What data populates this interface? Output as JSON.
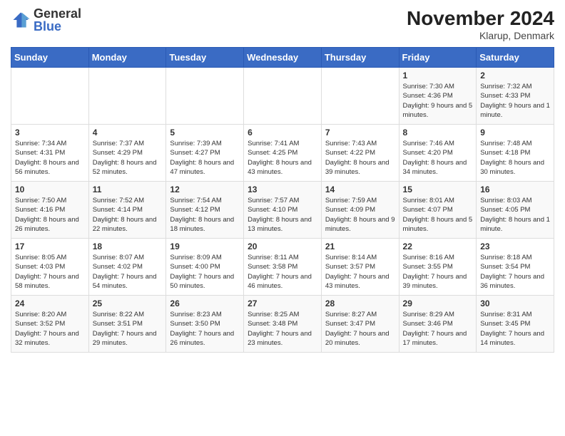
{
  "logo": {
    "text_top": "General",
    "text_bottom": "Blue"
  },
  "title": "November 2024",
  "subtitle": "Klarup, Denmark",
  "days_of_week": [
    "Sunday",
    "Monday",
    "Tuesday",
    "Wednesday",
    "Thursday",
    "Friday",
    "Saturday"
  ],
  "weeks": [
    [
      {
        "day": "",
        "info": ""
      },
      {
        "day": "",
        "info": ""
      },
      {
        "day": "",
        "info": ""
      },
      {
        "day": "",
        "info": ""
      },
      {
        "day": "",
        "info": ""
      },
      {
        "day": "1",
        "info": "Sunrise: 7:30 AM\nSunset: 4:36 PM\nDaylight: 9 hours and 5 minutes."
      },
      {
        "day": "2",
        "info": "Sunrise: 7:32 AM\nSunset: 4:33 PM\nDaylight: 9 hours and 1 minute."
      }
    ],
    [
      {
        "day": "3",
        "info": "Sunrise: 7:34 AM\nSunset: 4:31 PM\nDaylight: 8 hours and 56 minutes."
      },
      {
        "day": "4",
        "info": "Sunrise: 7:37 AM\nSunset: 4:29 PM\nDaylight: 8 hours and 52 minutes."
      },
      {
        "day": "5",
        "info": "Sunrise: 7:39 AM\nSunset: 4:27 PM\nDaylight: 8 hours and 47 minutes."
      },
      {
        "day": "6",
        "info": "Sunrise: 7:41 AM\nSunset: 4:25 PM\nDaylight: 8 hours and 43 minutes."
      },
      {
        "day": "7",
        "info": "Sunrise: 7:43 AM\nSunset: 4:22 PM\nDaylight: 8 hours and 39 minutes."
      },
      {
        "day": "8",
        "info": "Sunrise: 7:46 AM\nSunset: 4:20 PM\nDaylight: 8 hours and 34 minutes."
      },
      {
        "day": "9",
        "info": "Sunrise: 7:48 AM\nSunset: 4:18 PM\nDaylight: 8 hours and 30 minutes."
      }
    ],
    [
      {
        "day": "10",
        "info": "Sunrise: 7:50 AM\nSunset: 4:16 PM\nDaylight: 8 hours and 26 minutes."
      },
      {
        "day": "11",
        "info": "Sunrise: 7:52 AM\nSunset: 4:14 PM\nDaylight: 8 hours and 22 minutes."
      },
      {
        "day": "12",
        "info": "Sunrise: 7:54 AM\nSunset: 4:12 PM\nDaylight: 8 hours and 18 minutes."
      },
      {
        "day": "13",
        "info": "Sunrise: 7:57 AM\nSunset: 4:10 PM\nDaylight: 8 hours and 13 minutes."
      },
      {
        "day": "14",
        "info": "Sunrise: 7:59 AM\nSunset: 4:09 PM\nDaylight: 8 hours and 9 minutes."
      },
      {
        "day": "15",
        "info": "Sunrise: 8:01 AM\nSunset: 4:07 PM\nDaylight: 8 hours and 5 minutes."
      },
      {
        "day": "16",
        "info": "Sunrise: 8:03 AM\nSunset: 4:05 PM\nDaylight: 8 hours and 1 minute."
      }
    ],
    [
      {
        "day": "17",
        "info": "Sunrise: 8:05 AM\nSunset: 4:03 PM\nDaylight: 7 hours and 58 minutes."
      },
      {
        "day": "18",
        "info": "Sunrise: 8:07 AM\nSunset: 4:02 PM\nDaylight: 7 hours and 54 minutes."
      },
      {
        "day": "19",
        "info": "Sunrise: 8:09 AM\nSunset: 4:00 PM\nDaylight: 7 hours and 50 minutes."
      },
      {
        "day": "20",
        "info": "Sunrise: 8:11 AM\nSunset: 3:58 PM\nDaylight: 7 hours and 46 minutes."
      },
      {
        "day": "21",
        "info": "Sunrise: 8:14 AM\nSunset: 3:57 PM\nDaylight: 7 hours and 43 minutes."
      },
      {
        "day": "22",
        "info": "Sunrise: 8:16 AM\nSunset: 3:55 PM\nDaylight: 7 hours and 39 minutes."
      },
      {
        "day": "23",
        "info": "Sunrise: 8:18 AM\nSunset: 3:54 PM\nDaylight: 7 hours and 36 minutes."
      }
    ],
    [
      {
        "day": "24",
        "info": "Sunrise: 8:20 AM\nSunset: 3:52 PM\nDaylight: 7 hours and 32 minutes."
      },
      {
        "day": "25",
        "info": "Sunrise: 8:22 AM\nSunset: 3:51 PM\nDaylight: 7 hours and 29 minutes."
      },
      {
        "day": "26",
        "info": "Sunrise: 8:23 AM\nSunset: 3:50 PM\nDaylight: 7 hours and 26 minutes."
      },
      {
        "day": "27",
        "info": "Sunrise: 8:25 AM\nSunset: 3:48 PM\nDaylight: 7 hours and 23 minutes."
      },
      {
        "day": "28",
        "info": "Sunrise: 8:27 AM\nSunset: 3:47 PM\nDaylight: 7 hours and 20 minutes."
      },
      {
        "day": "29",
        "info": "Sunrise: 8:29 AM\nSunset: 3:46 PM\nDaylight: 7 hours and 17 minutes."
      },
      {
        "day": "30",
        "info": "Sunrise: 8:31 AM\nSunset: 3:45 PM\nDaylight: 7 hours and 14 minutes."
      }
    ]
  ]
}
